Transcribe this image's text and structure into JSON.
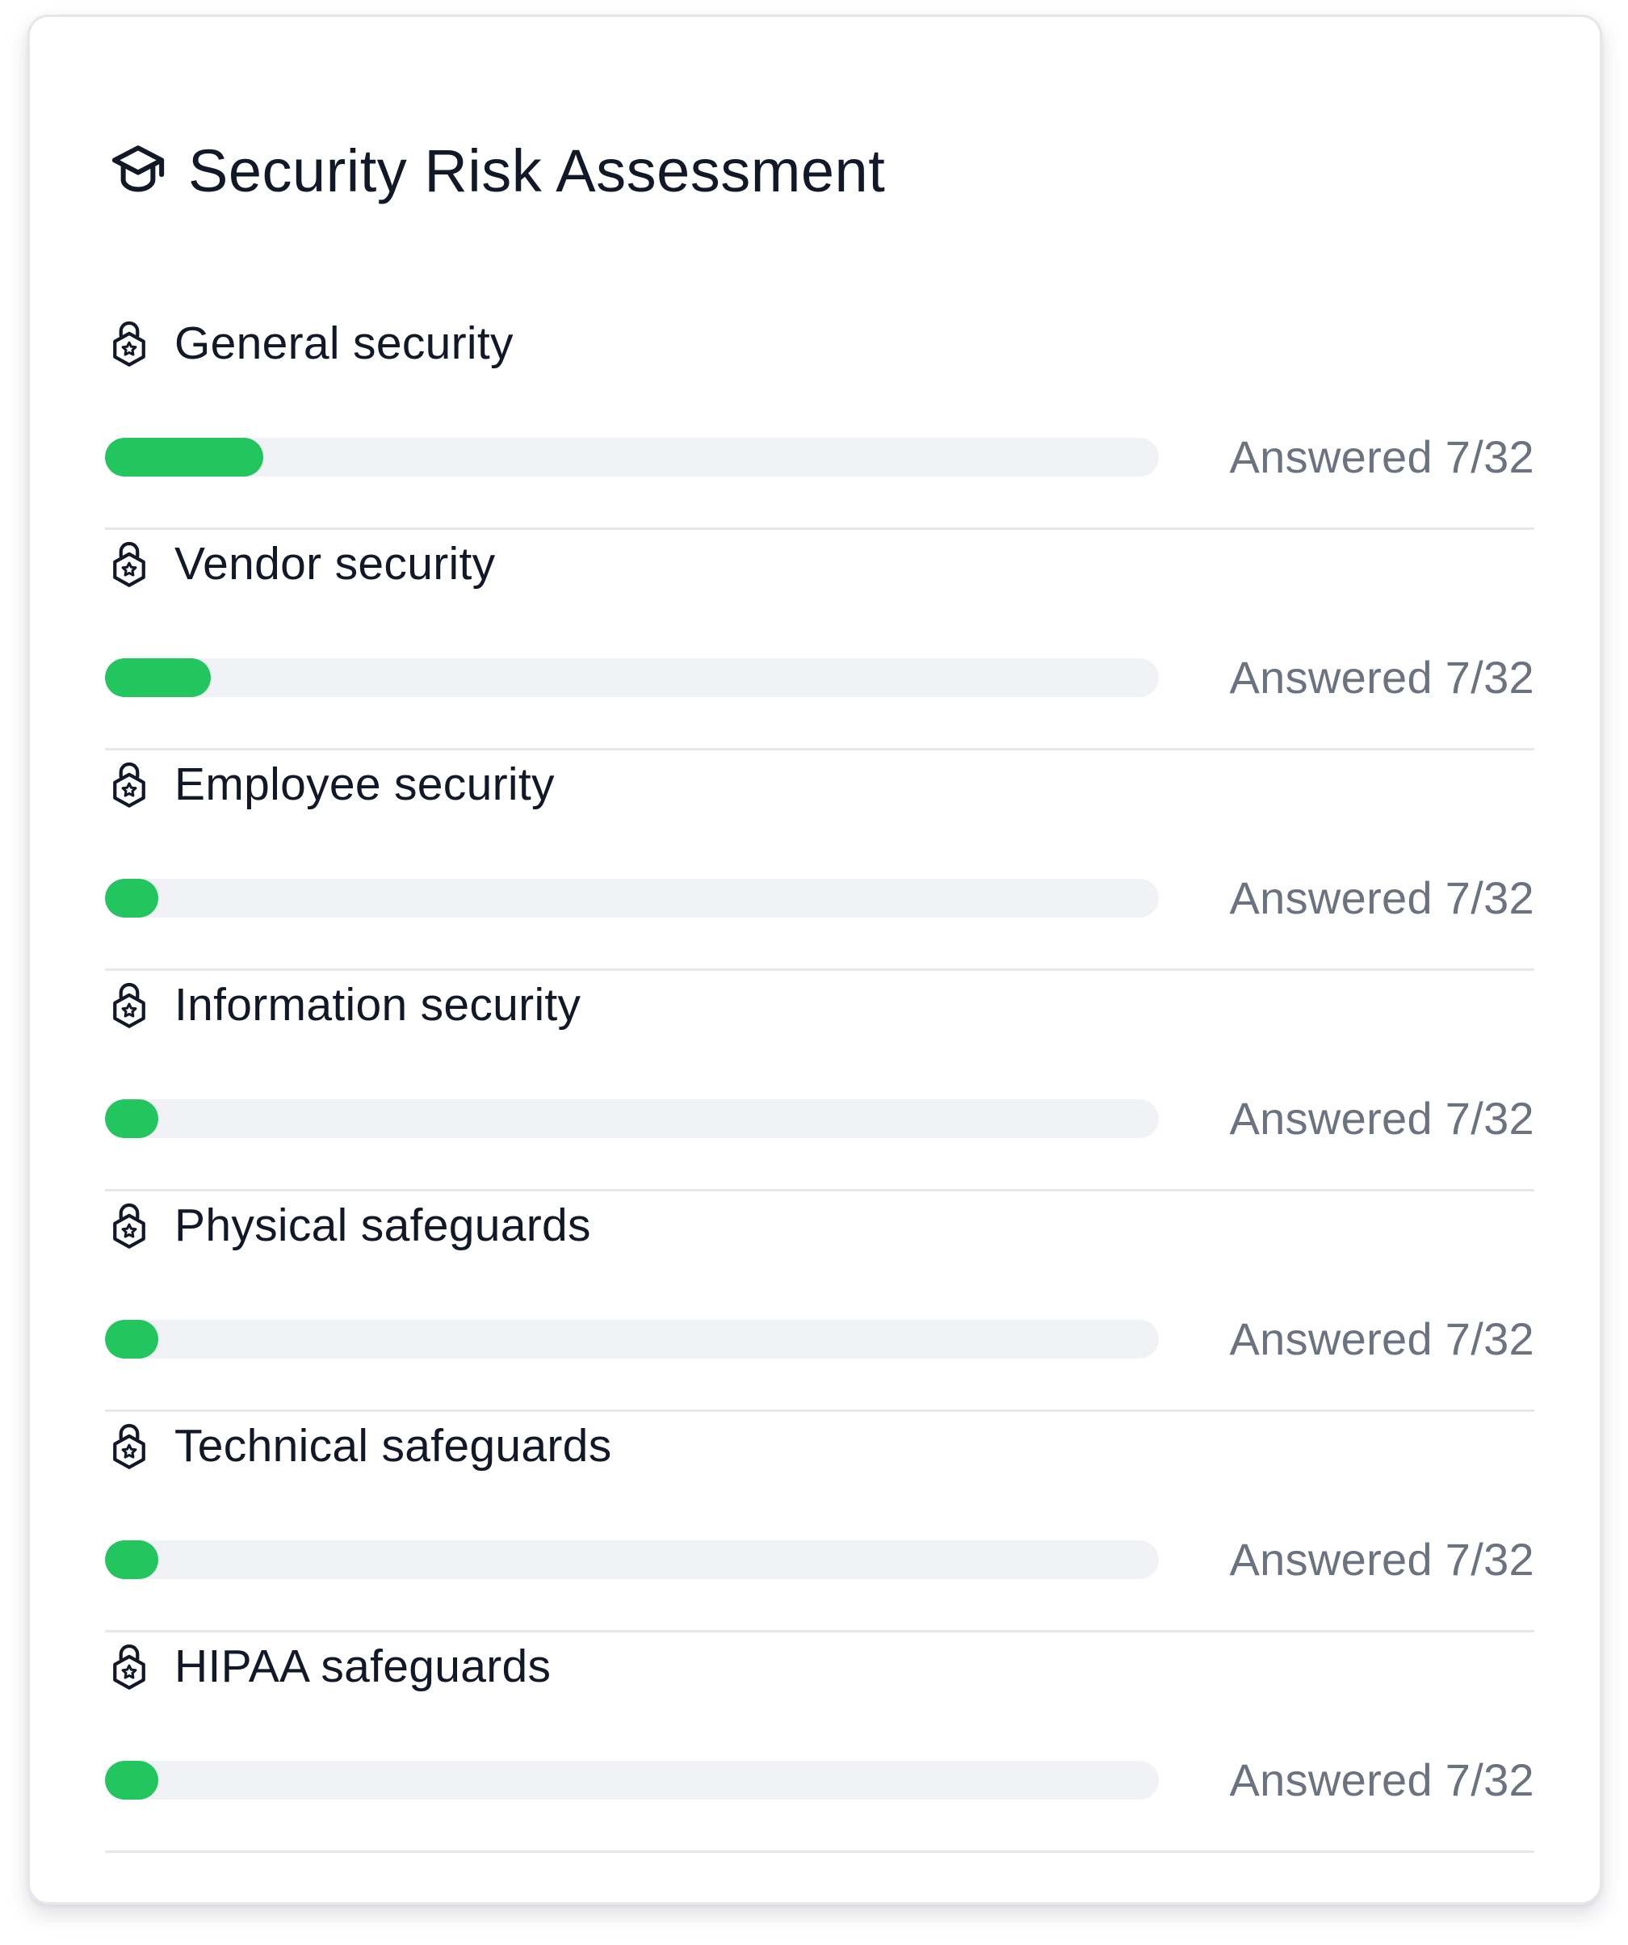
{
  "card": {
    "title": "Security Risk Assessment",
    "icon": "graduation-cap-icon"
  },
  "colors": {
    "progress_fill": "#22c55e",
    "progress_track": "#f1f2f5",
    "title_text": "#111827",
    "muted_text": "#6b7280"
  },
  "sections": [
    {
      "title": "General security",
      "icon": "lock-icon",
      "status": "Answered 7/32",
      "progress_fraction": 0.15
    },
    {
      "title": "Vendor security",
      "icon": "lock-icon",
      "status": "Answered 7/32",
      "progress_fraction": 0.1
    },
    {
      "title": "Employee security",
      "icon": "lock-icon",
      "status": "Answered 7/32",
      "progress_fraction": 0.05
    },
    {
      "title": "Information security",
      "icon": "lock-icon",
      "status": "Answered 7/32",
      "progress_fraction": 0.05
    },
    {
      "title": "Physical safeguards",
      "icon": "lock-icon",
      "status": "Answered 7/32",
      "progress_fraction": 0.05
    },
    {
      "title": "Technical safeguards",
      "icon": "lock-icon",
      "status": "Answered 7/32",
      "progress_fraction": 0.05
    },
    {
      "title": "HIPAA safeguards",
      "icon": "lock-icon",
      "status": "Answered 7/32",
      "progress_fraction": 0.05
    }
  ]
}
